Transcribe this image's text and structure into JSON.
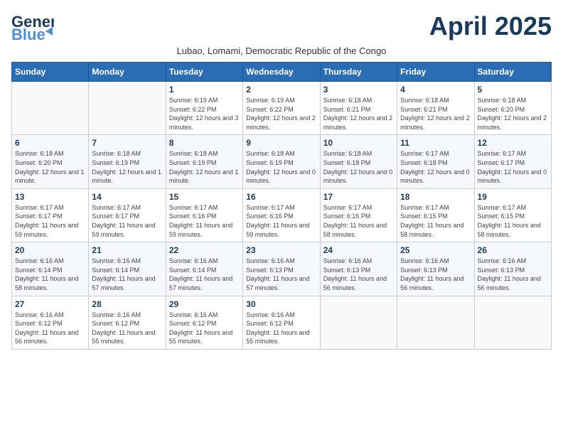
{
  "header": {
    "logo_line1": "General",
    "logo_line2": "Blue",
    "month_title": "April 2025",
    "subtitle": "Lubao, Lomami, Democratic Republic of the Congo"
  },
  "days_of_week": [
    "Sunday",
    "Monday",
    "Tuesday",
    "Wednesday",
    "Thursday",
    "Friday",
    "Saturday"
  ],
  "weeks": [
    [
      {
        "day": "",
        "info": ""
      },
      {
        "day": "",
        "info": ""
      },
      {
        "day": "1",
        "info": "Sunrise: 6:19 AM\nSunset: 6:22 PM\nDaylight: 12 hours and 3 minutes."
      },
      {
        "day": "2",
        "info": "Sunrise: 6:19 AM\nSunset: 6:22 PM\nDaylight: 12 hours and 2 minutes."
      },
      {
        "day": "3",
        "info": "Sunrise: 6:18 AM\nSunset: 6:21 PM\nDaylight: 12 hours and 2 minutes."
      },
      {
        "day": "4",
        "info": "Sunrise: 6:18 AM\nSunset: 6:21 PM\nDaylight: 12 hours and 2 minutes."
      },
      {
        "day": "5",
        "info": "Sunrise: 6:18 AM\nSunset: 6:20 PM\nDaylight: 12 hours and 2 minutes."
      }
    ],
    [
      {
        "day": "6",
        "info": "Sunrise: 6:18 AM\nSunset: 6:20 PM\nDaylight: 12 hours and 1 minute."
      },
      {
        "day": "7",
        "info": "Sunrise: 6:18 AM\nSunset: 6:19 PM\nDaylight: 12 hours and 1 minute."
      },
      {
        "day": "8",
        "info": "Sunrise: 6:18 AM\nSunset: 6:19 PM\nDaylight: 12 hours and 1 minute."
      },
      {
        "day": "9",
        "info": "Sunrise: 6:18 AM\nSunset: 6:19 PM\nDaylight: 12 hours and 0 minutes."
      },
      {
        "day": "10",
        "info": "Sunrise: 6:18 AM\nSunset: 6:18 PM\nDaylight: 12 hours and 0 minutes."
      },
      {
        "day": "11",
        "info": "Sunrise: 6:17 AM\nSunset: 6:18 PM\nDaylight: 12 hours and 0 minutes."
      },
      {
        "day": "12",
        "info": "Sunrise: 6:17 AM\nSunset: 6:17 PM\nDaylight: 12 hours and 0 minutes."
      }
    ],
    [
      {
        "day": "13",
        "info": "Sunrise: 6:17 AM\nSunset: 6:17 PM\nDaylight: 11 hours and 59 minutes."
      },
      {
        "day": "14",
        "info": "Sunrise: 6:17 AM\nSunset: 6:17 PM\nDaylight: 11 hours and 59 minutes."
      },
      {
        "day": "15",
        "info": "Sunrise: 6:17 AM\nSunset: 6:16 PM\nDaylight: 11 hours and 59 minutes."
      },
      {
        "day": "16",
        "info": "Sunrise: 6:17 AM\nSunset: 6:16 PM\nDaylight: 11 hours and 59 minutes."
      },
      {
        "day": "17",
        "info": "Sunrise: 6:17 AM\nSunset: 6:16 PM\nDaylight: 11 hours and 58 minutes."
      },
      {
        "day": "18",
        "info": "Sunrise: 6:17 AM\nSunset: 6:15 PM\nDaylight: 11 hours and 58 minutes."
      },
      {
        "day": "19",
        "info": "Sunrise: 6:17 AM\nSunset: 6:15 PM\nDaylight: 11 hours and 58 minutes."
      }
    ],
    [
      {
        "day": "20",
        "info": "Sunrise: 6:16 AM\nSunset: 6:14 PM\nDaylight: 11 hours and 58 minutes."
      },
      {
        "day": "21",
        "info": "Sunrise: 6:16 AM\nSunset: 6:14 PM\nDaylight: 11 hours and 57 minutes."
      },
      {
        "day": "22",
        "info": "Sunrise: 6:16 AM\nSunset: 6:14 PM\nDaylight: 11 hours and 57 minutes."
      },
      {
        "day": "23",
        "info": "Sunrise: 6:16 AM\nSunset: 6:13 PM\nDaylight: 11 hours and 57 minutes."
      },
      {
        "day": "24",
        "info": "Sunrise: 6:16 AM\nSunset: 6:13 PM\nDaylight: 11 hours and 56 minutes."
      },
      {
        "day": "25",
        "info": "Sunrise: 6:16 AM\nSunset: 6:13 PM\nDaylight: 11 hours and 56 minutes."
      },
      {
        "day": "26",
        "info": "Sunrise: 6:16 AM\nSunset: 6:13 PM\nDaylight: 11 hours and 56 minutes."
      }
    ],
    [
      {
        "day": "27",
        "info": "Sunrise: 6:16 AM\nSunset: 6:12 PM\nDaylight: 11 hours and 56 minutes."
      },
      {
        "day": "28",
        "info": "Sunrise: 6:16 AM\nSunset: 6:12 PM\nDaylight: 11 hours and 55 minutes."
      },
      {
        "day": "29",
        "info": "Sunrise: 6:16 AM\nSunset: 6:12 PM\nDaylight: 11 hours and 55 minutes."
      },
      {
        "day": "30",
        "info": "Sunrise: 6:16 AM\nSunset: 6:12 PM\nDaylight: 11 hours and 55 minutes."
      },
      {
        "day": "",
        "info": ""
      },
      {
        "day": "",
        "info": ""
      },
      {
        "day": "",
        "info": ""
      }
    ]
  ]
}
